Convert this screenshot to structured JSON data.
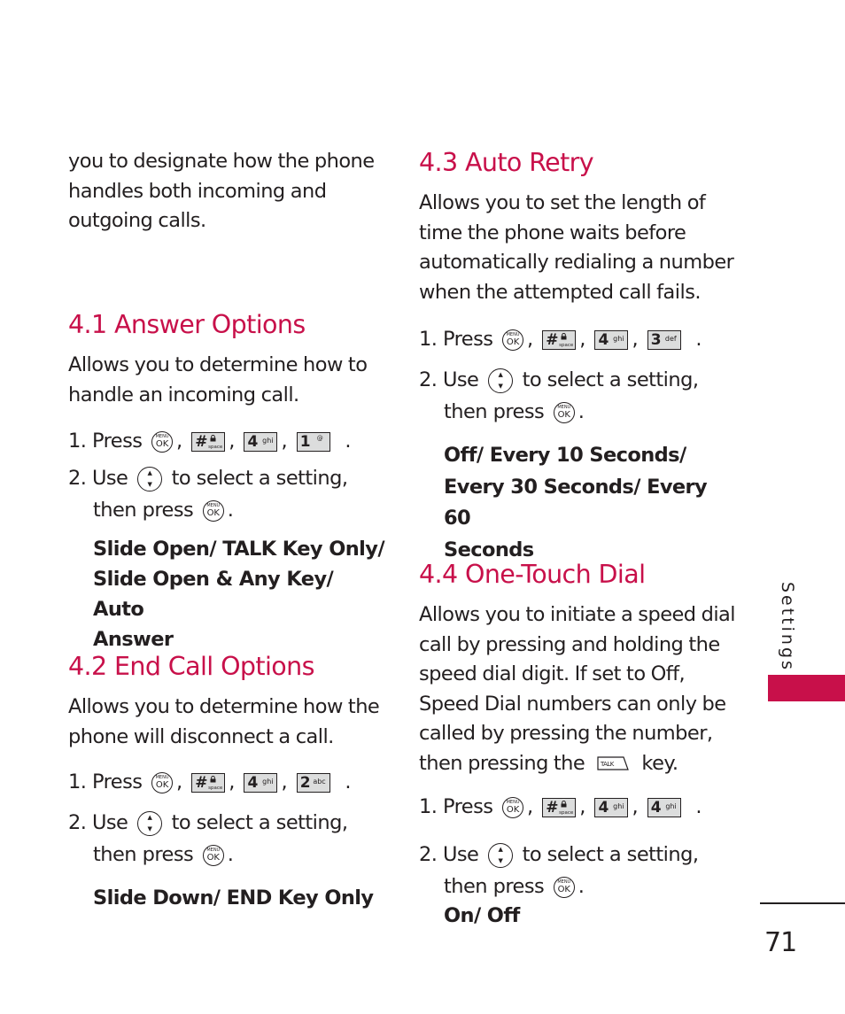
{
  "page": {
    "section_tab_label": "Settings",
    "section_tab_color": "#c8104a",
    "heading_color": "#c8104a",
    "page_number": "71"
  },
  "intro": {
    "lines": [
      "you to designate how the phone",
      "handles both incoming and",
      "outgoing calls."
    ]
  },
  "keys": {
    "menu_ok": {
      "top": "MENU",
      "bottom": "OK"
    },
    "hash": {
      "big": "#",
      "small": "space"
    },
    "four": {
      "big": "4",
      "small": "ghi"
    },
    "three": {
      "big": "3",
      "small": "def"
    },
    "two": {
      "big": "2",
      "small": "abc"
    },
    "one": {
      "big": "1",
      "small": "@"
    },
    "talk": "TALK",
    "nav": {
      "up": "▲",
      "down": "▼"
    }
  },
  "common": {
    "press_label": "1. Press",
    "comma": ",",
    "period": ".",
    "use_label": "2. Use",
    "to_select": "to select a setting,",
    "then_press": "then press"
  },
  "sections": [
    {
      "id": "4.1",
      "title": "4.1 Answer Options",
      "description_lines": [
        "Allows you to determine how to",
        "handle an incoming call."
      ],
      "key_sequence": [
        "MENU/OK",
        "#",
        "4 ghi",
        "1"
      ],
      "options_lines": [
        "Slide Open/ TALK Key Only/",
        "Slide Open & Any Key/ Auto",
        "Answer"
      ]
    },
    {
      "id": "4.2",
      "title": "4.2 End Call Options",
      "description_lines": [
        "Allows you to determine how the",
        "phone will disconnect a call."
      ],
      "key_sequence": [
        "MENU/OK",
        "#",
        "4 ghi",
        "2 abc"
      ],
      "options_lines": [
        "Slide Down/ END Key Only"
      ]
    },
    {
      "id": "4.3",
      "title": "4.3 Auto Retry",
      "description_lines": [
        "Allows you to set the length of",
        "time the phone waits before",
        "automatically redialing a number",
        "when the attempted call fails."
      ],
      "key_sequence": [
        "MENU/OK",
        "#",
        "4 ghi",
        "3 def"
      ],
      "options_lines": [
        "Off/ Every 10 Seconds/",
        "Every 30 Seconds/ Every 60",
        "Seconds"
      ]
    },
    {
      "id": "4.4",
      "title": "4.4 One-Touch Dial",
      "description_lines": [
        "Allows you to initiate a speed dial",
        "call by pressing and holding the",
        "speed dial digit. If set to Off,",
        "Speed Dial numbers can only be",
        "called by pressing the number,"
      ],
      "description_last_prefix": "then pressing the",
      "description_last_suffix": "key.",
      "key_sequence": [
        "MENU/OK",
        "#",
        "4 ghi",
        "4 ghi"
      ],
      "options_lines": [
        "On/ Off"
      ]
    }
  ]
}
